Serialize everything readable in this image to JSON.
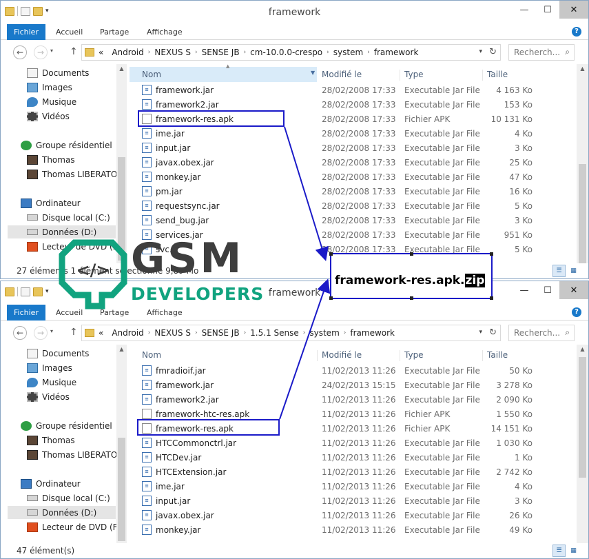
{
  "window_top": {
    "title": "framework",
    "qat": [
      "folder",
      "properties",
      "new-folder"
    ],
    "ribbon_tabs": [
      "Fichier",
      "Accueil",
      "Partage",
      "Affichage"
    ],
    "breadcrumb": [
      "Android",
      "NEXUS S",
      "SENSE JB",
      "cm-10.0.0-crespo",
      "system",
      "framework"
    ],
    "search_placeholder": "Recherch...",
    "nav": {
      "items": [
        {
          "label": "Documents",
          "icon": "documents-icon"
        },
        {
          "label": "Images",
          "icon": "images-icon"
        },
        {
          "label": "Musique",
          "icon": "music-icon"
        },
        {
          "label": "Vidéos",
          "icon": "videos-icon"
        },
        {
          "label": "Groupe résidentiel",
          "icon": "homegroup-icon"
        },
        {
          "label": "Thomas",
          "icon": "user-icon"
        },
        {
          "label": "Thomas LIBERATO",
          "icon": "user-icon"
        },
        {
          "label": "Ordinateur",
          "icon": "computer-icon"
        },
        {
          "label": "Disque local (C:)",
          "icon": "drive-icon"
        },
        {
          "label": "Données (D:)",
          "icon": "drive-icon"
        },
        {
          "label": "Lecteur de DVD (F:",
          "icon": "dvd-icon"
        }
      ]
    },
    "columns": {
      "name": "Nom",
      "modified": "Modifié le",
      "type": "Type",
      "size": "Taille"
    },
    "files": [
      {
        "name": "framework.jar",
        "date": "28/02/2008 17:33",
        "type": "Executable Jar File",
        "size": "4 163 Ko",
        "kind": "jar"
      },
      {
        "name": "framework2.jar",
        "date": "28/02/2008 17:33",
        "type": "Executable Jar File",
        "size": "153 Ko",
        "kind": "jar"
      },
      {
        "name": "framework-res.apk",
        "date": "28/02/2008 17:33",
        "type": "Fichier APK",
        "size": "10 131 Ko",
        "kind": "apk"
      },
      {
        "name": "ime.jar",
        "date": "28/02/2008 17:33",
        "type": "Executable Jar File",
        "size": "4 Ko",
        "kind": "jar"
      },
      {
        "name": "input.jar",
        "date": "28/02/2008 17:33",
        "type": "Executable Jar File",
        "size": "3 Ko",
        "kind": "jar"
      },
      {
        "name": "javax.obex.jar",
        "date": "28/02/2008 17:33",
        "type": "Executable Jar File",
        "size": "25 Ko",
        "kind": "jar"
      },
      {
        "name": "monkey.jar",
        "date": "28/02/2008 17:33",
        "type": "Executable Jar File",
        "size": "47 Ko",
        "kind": "jar"
      },
      {
        "name": "pm.jar",
        "date": "28/02/2008 17:33",
        "type": "Executable Jar File",
        "size": "16 Ko",
        "kind": "jar"
      },
      {
        "name": "requestsync.jar",
        "date": "28/02/2008 17:33",
        "type": "Executable Jar File",
        "size": "5 Ko",
        "kind": "jar"
      },
      {
        "name": "send_bug.jar",
        "date": "28/02/2008 17:33",
        "type": "Executable Jar File",
        "size": "3 Ko",
        "kind": "jar"
      },
      {
        "name": "services.jar",
        "date": "28/02/2008 17:33",
        "type": "Executable Jar File",
        "size": "951 Ko",
        "kind": "jar"
      },
      {
        "name": "svc.",
        "date": "28/02/2008 17:33",
        "type": "Executable Jar File",
        "size": "5 Ko",
        "kind": "jar"
      }
    ],
    "status": "27 éléments   1 élément sélectionné  9,89 Mo"
  },
  "window_bottom": {
    "title": "framework",
    "qat": [
      "folder",
      "properties",
      "new-folder"
    ],
    "ribbon_tabs": [
      "Fichier",
      "Accueil",
      "Partage",
      "Affichage"
    ],
    "breadcrumb": [
      "Android",
      "NEXUS S",
      "SENSE JB",
      "1.5.1 Sense",
      "system",
      "framework"
    ],
    "search_placeholder": "Recherch...",
    "nav": {
      "items": [
        {
          "label": "Documents",
          "icon": "documents-icon"
        },
        {
          "label": "Images",
          "icon": "images-icon"
        },
        {
          "label": "Musique",
          "icon": "music-icon"
        },
        {
          "label": "Vidéos",
          "icon": "videos-icon"
        },
        {
          "label": "Groupe résidentiel",
          "icon": "homegroup-icon"
        },
        {
          "label": "Thomas",
          "icon": "user-icon"
        },
        {
          "label": "Thomas LIBERATO",
          "icon": "user-icon"
        },
        {
          "label": "Ordinateur",
          "icon": "computer-icon"
        },
        {
          "label": "Disque local (C:)",
          "icon": "drive-icon"
        },
        {
          "label": "Données (D:)",
          "icon": "drive-icon"
        },
        {
          "label": "Lecteur de DVD (F:)",
          "icon": "dvd-icon"
        }
      ]
    },
    "columns": {
      "name": "Nom",
      "modified": "Modifié le",
      "type": "Type",
      "size": "Taille"
    },
    "files": [
      {
        "name": "fmradioif.jar",
        "date": "11/02/2013 11:26",
        "type": "Executable Jar File",
        "size": "50 Ko",
        "kind": "jar"
      },
      {
        "name": "framework.jar",
        "date": "24/02/2013 15:15",
        "type": "Executable Jar File",
        "size": "3 278 Ko",
        "kind": "jar"
      },
      {
        "name": "framework2.jar",
        "date": "11/02/2013 11:26",
        "type": "Executable Jar File",
        "size": "2 090 Ko",
        "kind": "jar"
      },
      {
        "name": "framework-htc-res.apk",
        "date": "11/02/2013 11:26",
        "type": "Fichier APK",
        "size": "1 550 Ko",
        "kind": "apk"
      },
      {
        "name": "framework-res.apk",
        "date": "11/02/2013 11:26",
        "type": "Fichier APK",
        "size": "14 151 Ko",
        "kind": "apk"
      },
      {
        "name": "HTCCommonctrl.jar",
        "date": "11/02/2013 11:26",
        "type": "Executable Jar File",
        "size": "1 030 Ko",
        "kind": "jar"
      },
      {
        "name": "HTCDev.jar",
        "date": "11/02/2013 11:26",
        "type": "Executable Jar File",
        "size": "1 Ko",
        "kind": "jar"
      },
      {
        "name": "HTCExtension.jar",
        "date": "11/02/2013 11:26",
        "type": "Executable Jar File",
        "size": "2 742 Ko",
        "kind": "jar"
      },
      {
        "name": "ime.jar",
        "date": "11/02/2013 11:26",
        "type": "Executable Jar File",
        "size": "4 Ko",
        "kind": "jar"
      },
      {
        "name": "input.jar",
        "date": "11/02/2013 11:26",
        "type": "Executable Jar File",
        "size": "3 Ko",
        "kind": "jar"
      },
      {
        "name": "javax.obex.jar",
        "date": "11/02/2013 11:26",
        "type": "Executable Jar File",
        "size": "26 Ko",
        "kind": "jar"
      },
      {
        "name": "monkey.jar",
        "date": "11/02/2013 11:26",
        "type": "Executable Jar File",
        "size": "49 Ko",
        "kind": "jar"
      }
    ],
    "status": "47 élément(s)"
  },
  "callout": {
    "base": "framework-res.apk.",
    "ext": "zip"
  },
  "logo": {
    "line1": "GSM",
    "line2": "DEVELOPERS",
    "glyph": "</>"
  },
  "colors": {
    "accent": "#1979ca",
    "highlight": "#1a1ac8",
    "logo_green": "#11a37f",
    "logo_gray": "#3e3e3e"
  }
}
